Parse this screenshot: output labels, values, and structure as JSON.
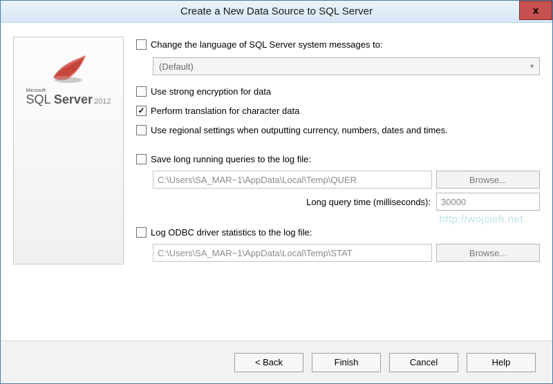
{
  "window": {
    "title": "Create a New Data Source to SQL Server",
    "close_label": "x"
  },
  "sidebar": {
    "logo_alt": "SQL Server logo",
    "brand_small": "Microsoft",
    "brand_main_html": "SQL Server",
    "brand_year": "2012"
  },
  "watermark": "http://wojcieh.net",
  "form": {
    "change_lang": {
      "checked": false,
      "label": "Change the language of SQL Server system messages to:",
      "select_value": "(Default)"
    },
    "strong_encryption": {
      "checked": false,
      "label": "Use strong encryption for data"
    },
    "perform_translation": {
      "checked": true,
      "label": "Perform translation for character data"
    },
    "regional_settings": {
      "checked": false,
      "label": "Use regional settings when outputting currency, numbers, dates and times."
    },
    "save_long_queries": {
      "checked": false,
      "label": "Save long running queries to the log file:",
      "path": "C:\\Users\\SA_MAR~1\\AppData\\Local\\Temp\\QUER",
      "browse": "Browse...",
      "time_label": "Long query time (milliseconds):",
      "time_value": "30000"
    },
    "log_odbc": {
      "checked": false,
      "label": "Log ODBC driver statistics to the log file:",
      "path": "C:\\Users\\SA_MAR~1\\AppData\\Local\\Temp\\STAT",
      "browse": "Browse..."
    }
  },
  "footer": {
    "back": "< Back",
    "finish": "Finish",
    "cancel": "Cancel",
    "help": "Help"
  }
}
